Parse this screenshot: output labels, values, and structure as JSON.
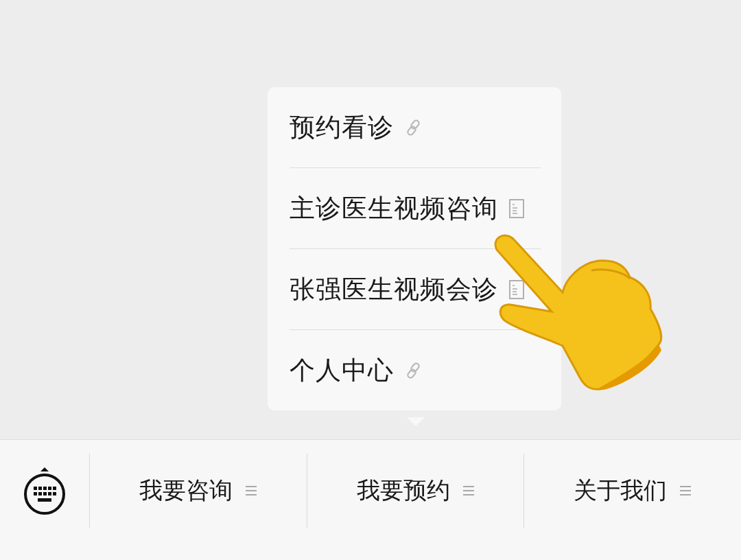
{
  "menu": {
    "items": [
      {
        "label": "预约看诊",
        "kind": "link"
      },
      {
        "label": "主诊医生视频咨询",
        "kind": "page"
      },
      {
        "label": "张强医生视频会诊",
        "kind": "page"
      },
      {
        "label": "个人中心",
        "kind": "link"
      }
    ]
  },
  "bottom_bar": {
    "tabs": [
      {
        "label": "我要咨询"
      },
      {
        "label": "我要预约"
      },
      {
        "label": "关于我们"
      }
    ]
  }
}
